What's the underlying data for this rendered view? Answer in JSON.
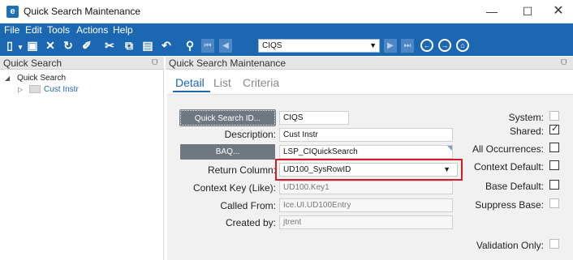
{
  "window": {
    "title": "Quick Search Maintenance",
    "app_icon": "e",
    "minimize": "—",
    "maximize": "☐",
    "close": "✕"
  },
  "menu": [
    "File",
    "Edit",
    "Tools",
    "Actions",
    "Help"
  ],
  "toolbar": {
    "record_combo_value": "CIQS",
    "icons": [
      "new-icon",
      "save-icon",
      "delete-icon",
      "refresh-icon",
      "clear-icon",
      "cut-icon",
      "copy-icon",
      "paste-icon",
      "undo-icon",
      "search-icon"
    ]
  },
  "left_panel": {
    "title": "Quick Search",
    "tree_root": "Quick Search",
    "tree_child": "Cust Instr"
  },
  "right_panel": {
    "title": "Quick Search Maintenance",
    "tabs": [
      "Detail",
      "List",
      "Criteria"
    ],
    "active_tab": "Detail"
  },
  "form": {
    "quick_search_id_button": "Quick Search ID...",
    "quick_search_id_value": "CIQS",
    "description_label": "Description:",
    "description_value": "Cust Instr",
    "baq_button": "BAQ...",
    "baq_value": "LSP_CIQuickSearch",
    "return_column_label": "Return Column:",
    "return_column_value": "UD100_SysRowID",
    "context_key_label": "Context Key (Like):",
    "context_key_value": "UD100.Key1",
    "called_from_label": "Called From:",
    "called_from_value": "Ice.UI.UD100Entry",
    "created_by_label": "Created by:",
    "created_by_value": "jtrent"
  },
  "flags": {
    "system_label": "System:",
    "shared_label": "Shared:",
    "all_occurrences_label": "All Occurrences:",
    "context_default_label": "Context Default:",
    "base_default_label": "Base Default:",
    "suppress_base_label": "Suppress Base:",
    "validation_only_label": "Validation Only:",
    "shared_checked": true
  },
  "colors": {
    "menubar": "#1b67b1",
    "accent": "#1b67b1",
    "highlight": "#d11e26"
  }
}
